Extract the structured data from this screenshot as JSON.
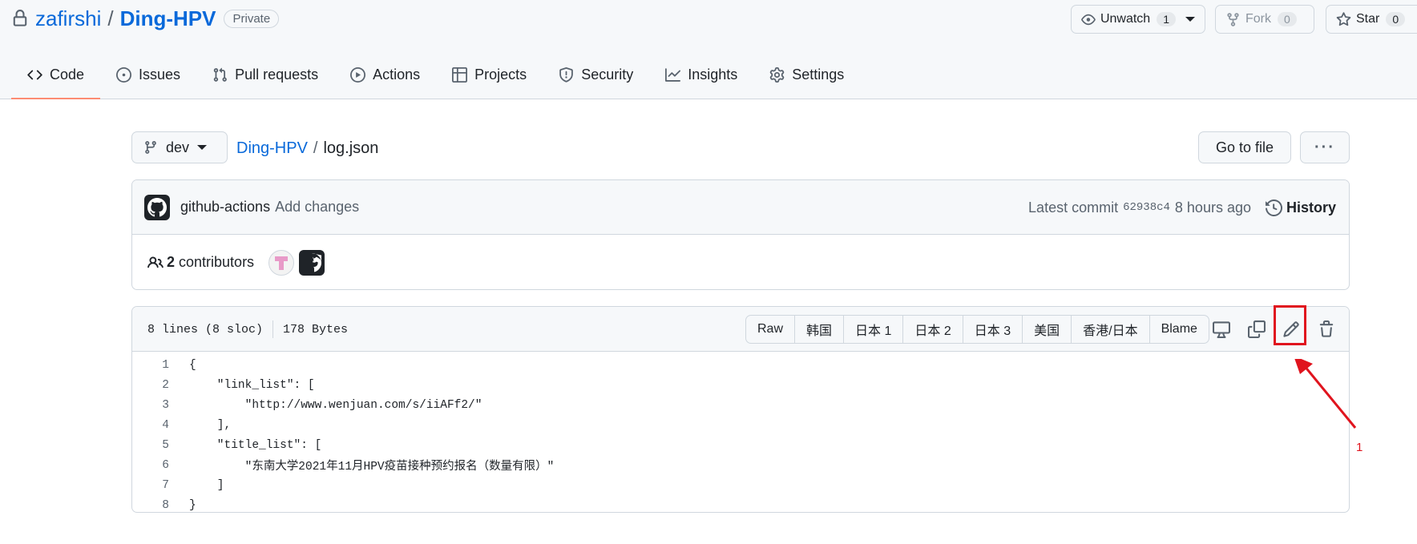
{
  "repo": {
    "owner": "zafirshi",
    "separator": "/",
    "name": "Ding-HPV",
    "visibility": "Private"
  },
  "header_actions": {
    "unwatch": {
      "label": "Unwatch",
      "count": "1"
    },
    "fork": {
      "label": "Fork",
      "count": "0"
    },
    "star": {
      "label": "Star",
      "count": "0"
    }
  },
  "nav": {
    "tabs": [
      {
        "label": "Code",
        "icon": "code-icon",
        "selected": true
      },
      {
        "label": "Issues",
        "icon": "issue-icon"
      },
      {
        "label": "Pull requests",
        "icon": "pull-request-icon"
      },
      {
        "label": "Actions",
        "icon": "play-icon"
      },
      {
        "label": "Projects",
        "icon": "table-icon"
      },
      {
        "label": "Security",
        "icon": "shield-icon"
      },
      {
        "label": "Insights",
        "icon": "graph-icon"
      },
      {
        "label": "Settings",
        "icon": "gear-icon"
      }
    ]
  },
  "file_header": {
    "branch": "dev",
    "breadcrumb_repo": "Ding-HPV",
    "breadcrumb_sep": "/",
    "file_name": "log.json",
    "go_to_file": "Go to file",
    "more": "···"
  },
  "commit": {
    "author": "github-actions",
    "message": "Add changes",
    "latest_label": "Latest commit",
    "sha": "62938c4",
    "time": "8 hours ago",
    "history": "History"
  },
  "contributors": {
    "count": "2",
    "label": "contributors"
  },
  "file": {
    "lines_info": "8 lines (8 sloc)",
    "size": "178 Bytes",
    "view_buttons": [
      "Raw",
      "韩国",
      "日本 1",
      "日本 2",
      "日本 3",
      "美国",
      "香港/日本",
      "Blame"
    ],
    "code_lines": [
      {
        "num": "1",
        "text": "{"
      },
      {
        "num": "2",
        "text": "    \"link_list\": ["
      },
      {
        "num": "3",
        "text": "        \"http://www.wenjuan.com/s/iiAFf2/\""
      },
      {
        "num": "4",
        "text": "    ],"
      },
      {
        "num": "5",
        "text": "    \"title_list\": ["
      },
      {
        "num": "6",
        "text": "        \"东南大学2021年11月HPV疫苗接种预约报名（数量有限）\""
      },
      {
        "num": "7",
        "text": "    ]"
      },
      {
        "num": "8",
        "text": "}"
      }
    ]
  },
  "annotation": {
    "label": "1",
    "color": "#e0141e"
  }
}
